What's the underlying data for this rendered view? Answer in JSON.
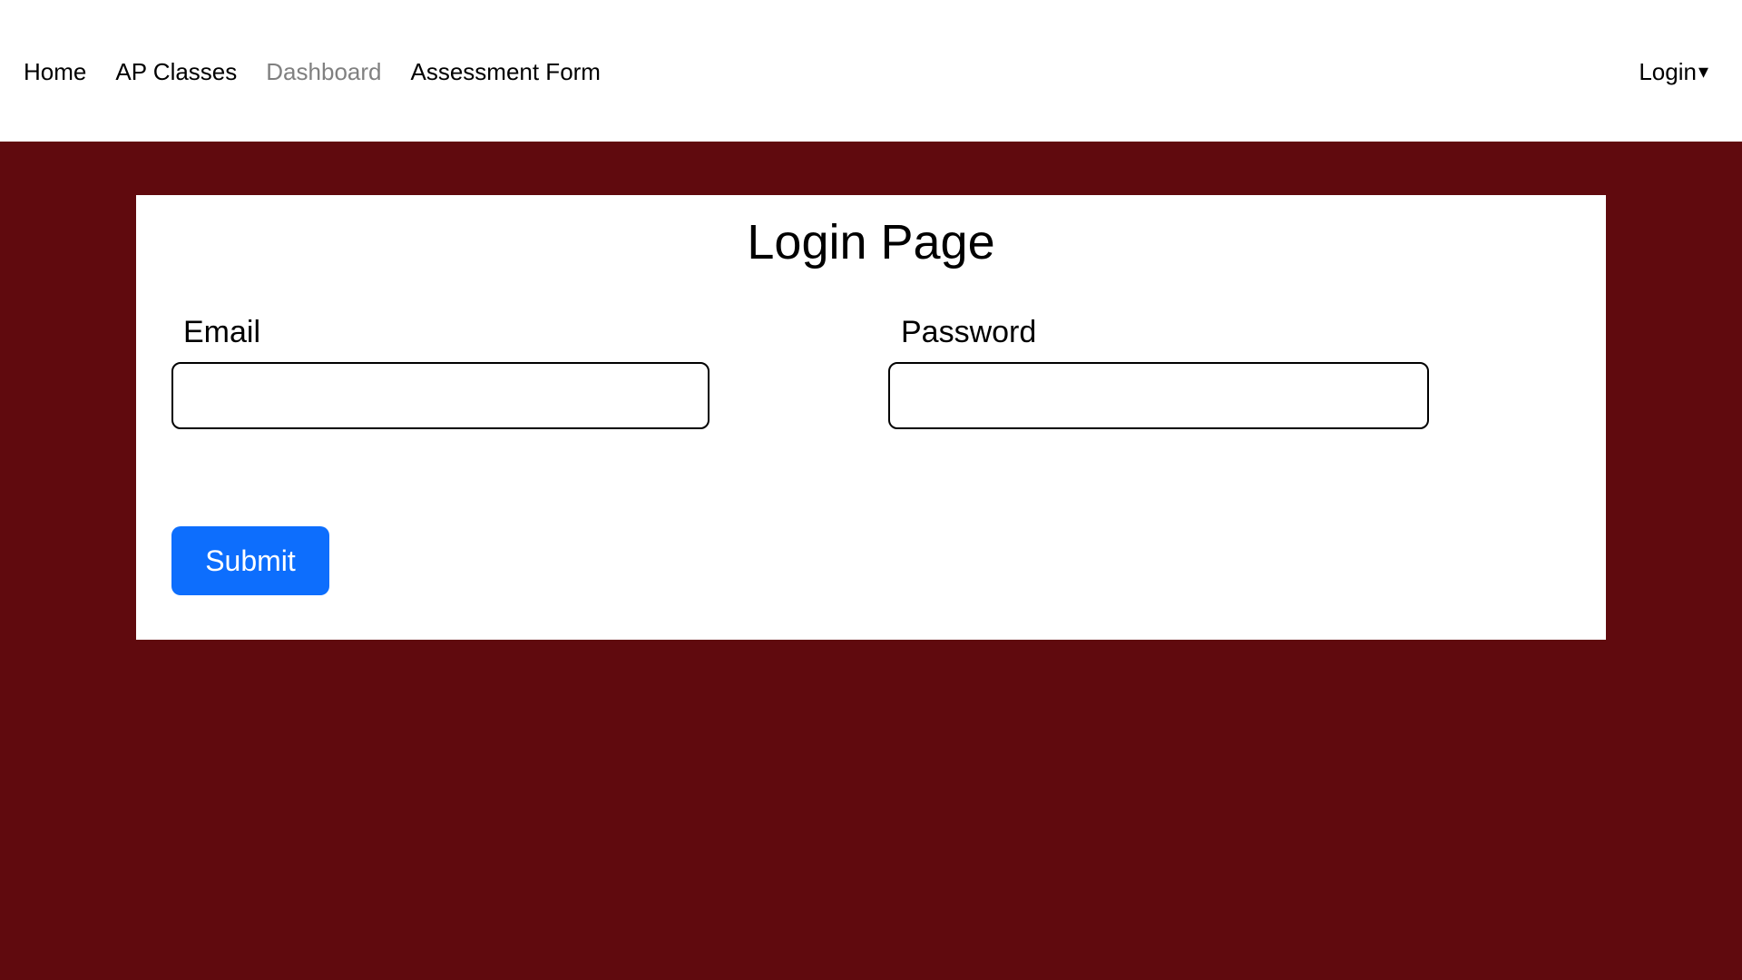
{
  "navbar": {
    "links": [
      {
        "label": "Home"
      },
      {
        "label": "AP Classes"
      },
      {
        "label": "Dashboard"
      },
      {
        "label": "Assessment Form"
      }
    ],
    "login_label": "Login",
    "login_caret": "▾"
  },
  "card": {
    "title": "Login Page",
    "email_label": "Email",
    "email_value": "",
    "password_label": "Password",
    "password_value": "",
    "submit_label": "Submit"
  },
  "colors": {
    "background": "#600a0e",
    "card": "#ffffff",
    "nav_muted": "#808080",
    "submit_button": "#0d6efd"
  }
}
